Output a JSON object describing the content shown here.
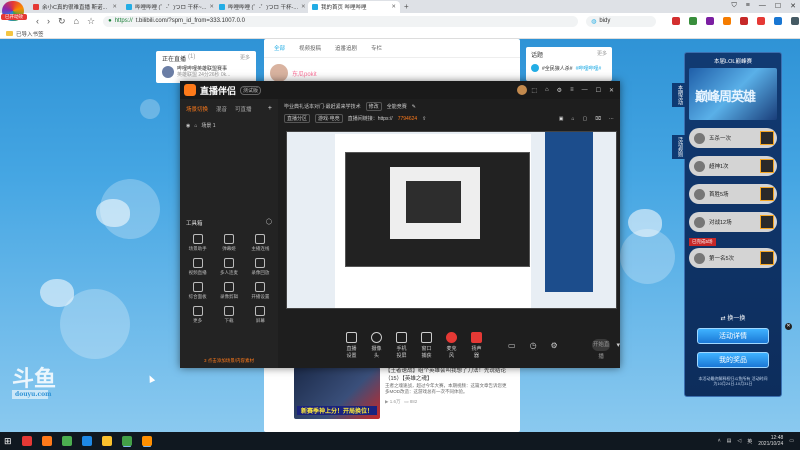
{
  "browser": {
    "badge_label": "已开动效",
    "tabs": [
      {
        "label": "余小C真的很难直播 斯诺..."
      },
      {
        "label": "哔哩哔哩 (゜-゜)つロ 干杯~..."
      },
      {
        "label": "哔哩哔哩 (゜-゜)つロ 干杯-..."
      },
      {
        "label": "我的首页 哔哩哔哩"
      }
    ],
    "url_proto": "https://",
    "url_rest": "t.bilibili.com/?spm_id_from=333.1007.0.0",
    "search_text": "bidy",
    "bookmark_label": "已导入书签"
  },
  "page": {
    "live_card": {
      "title": "正在直播",
      "count": "(1)",
      "more": "更多",
      "streamer": "哔哩哔哩英雄联盟赛事",
      "sub": "英雄联盟 24分26秒 0k..."
    },
    "feed_tabs": [
      "全部",
      "视频投稿",
      "追番追剧",
      "专栏"
    ],
    "feed_user": "东瓜pokit",
    "post": {
      "thumb_text": "新赛季神上分！开局换位！",
      "title": "【王者速战】组个英雄会叫我想了刀法！先说结论（15）【英雄之魂】",
      "desc": "王者之魂速战，超过今年大赛，本期视频：这篇文章告诉您更多MOD改造：这游戏总有一次不同体验。",
      "views": "1.6万",
      "comments": "882"
    },
    "topic_card": {
      "title": "话题",
      "more": "更多",
      "item": "#全民狼人杀#",
      "item_hl": "#哔哩哔哩#"
    },
    "watermark": "斗鱼",
    "watermark_sub": "douyu.com"
  },
  "activity": {
    "title": "本届LOL巅峰赛",
    "banner_text": "巅峰周英雄",
    "side_label_1": "本期活动",
    "side_label_2": "活动规则",
    "rewards": [
      "五杀一次",
      "超神1次",
      "首胜5场",
      "对战12场",
      "第一名5次"
    ],
    "tag": "已完成5场",
    "swap": "换一换",
    "detail_btn": "活动详情",
    "prize_btn": "我的奖品",
    "footer": "本活动最终解释权归斗鱼所有 活动时间为10月24日-10月31日"
  },
  "obs": {
    "title": "直播伴侣",
    "version": "测试版",
    "left_tabs": [
      "场景切换",
      "混音",
      "可直播"
    ],
    "scene": "场景 1",
    "tools_title": "工具箱",
    "tools": [
      "场景助手",
      "弹幕姬",
      "主播连线",
      "视频直播",
      "多人连麦",
      "录像回放",
      "综合面板",
      "录像剪辑",
      "开播设置",
      "更多",
      "下载",
      "屏幕"
    ],
    "left_footer": "3 点击添加场景/内容素材",
    "info_line1": "毕业典礼话本对门·最赶紧来学技术",
    "info_pill1": "修改",
    "info_tag": "全能竞赛",
    "info_pill2": "直播分区",
    "info_pill3": "游戏·电竞",
    "info_link": "直播间链接：https://",
    "info_room": "7794624",
    "bottom_buttons": [
      "直播设置",
      "摄像头",
      "手机投屏",
      "窗口捕获",
      "麦克风",
      "扬声器"
    ],
    "start_label": "开始直播"
  },
  "taskbar": {
    "time": "12:48",
    "date": "2021/10/24"
  }
}
